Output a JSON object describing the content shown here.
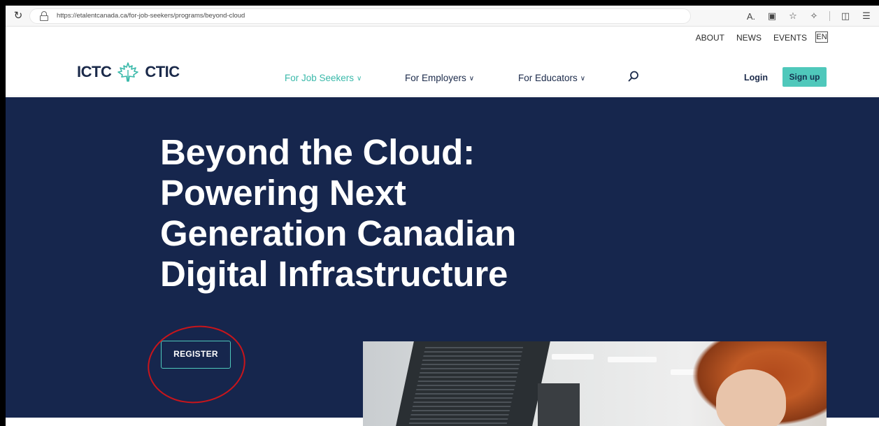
{
  "browser": {
    "url": "https://etalentcanada.ca/for-job-seekers/programs/beyond-cloud",
    "icons": [
      "reload-icon",
      "lock-icon",
      "read-aloud-icon",
      "split-screen-icon",
      "favorite-icon",
      "extensions-icon",
      "sidebar-icon",
      "favorites-list-icon"
    ]
  },
  "utility_nav": {
    "links": [
      "ABOUT",
      "NEWS",
      "EVENTS"
    ],
    "language": "EN"
  },
  "header": {
    "logo_left": "ICTC",
    "logo_right": "CTIC",
    "nav": [
      {
        "label": "For Job Seekers",
        "active": true
      },
      {
        "label": "For Employers",
        "active": false
      },
      {
        "label": "For Educators",
        "active": false
      }
    ],
    "login": "Login",
    "signup": "Sign up"
  },
  "hero": {
    "title_lines": [
      "Beyond the Cloud:",
      "Powering Next",
      "Generation Canadian",
      "Digital Infrastructure"
    ],
    "register": "REGISTER"
  },
  "colors": {
    "hero_bg": "#16264d",
    "accent": "#4fc8bb",
    "active_nav": "#3ab9aa",
    "annotation": "#c8151b"
  }
}
